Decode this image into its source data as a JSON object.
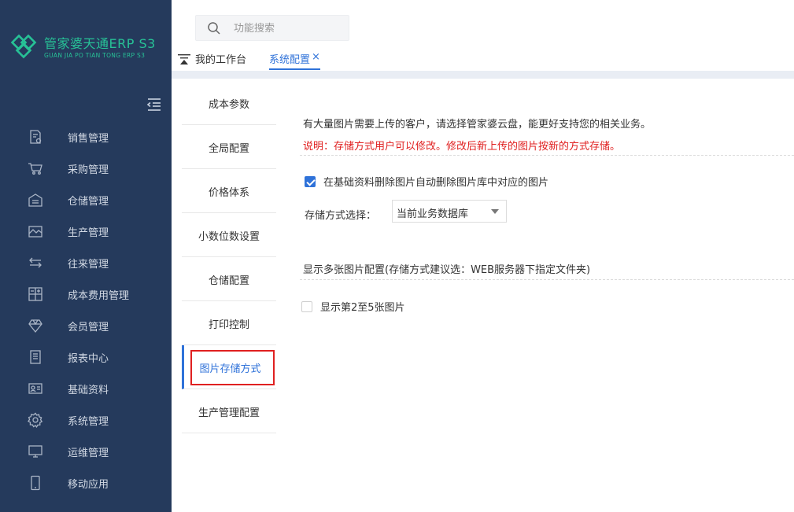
{
  "app": {
    "logo_title": "管家婆天通ERP S3",
    "logo_subtitle": "GUAN JIA PO TIAN TONG ERP S3"
  },
  "sidebar": {
    "items": [
      {
        "label": "销售管理",
        "icon": "sales-doc-icon"
      },
      {
        "label": "采购管理",
        "icon": "cart-icon"
      },
      {
        "label": "仓储管理",
        "icon": "warehouse-icon"
      },
      {
        "label": "生产管理",
        "icon": "factory-icon"
      },
      {
        "label": "往来管理",
        "icon": "exchange-arrows-icon"
      },
      {
        "label": "成本费用管理",
        "icon": "calculator-icon"
      },
      {
        "label": "会员管理",
        "icon": "diamond-icon"
      },
      {
        "label": "报表中心",
        "icon": "report-icon"
      },
      {
        "label": "基础资料",
        "icon": "id-card-icon"
      },
      {
        "label": "系统管理",
        "icon": "gear-icon"
      },
      {
        "label": "运维管理",
        "icon": "monitor-icon"
      },
      {
        "label": "移动应用",
        "icon": "mobile-icon"
      }
    ]
  },
  "search": {
    "placeholder": "功能搜索"
  },
  "tabs": {
    "home_label": "我的工作台",
    "active_label": "系统配置",
    "close_glyph": "×"
  },
  "settings_menu": {
    "items": [
      {
        "label": "成本参数"
      },
      {
        "label": "全局配置"
      },
      {
        "label": "价格体系"
      },
      {
        "label": "小数位数设置"
      },
      {
        "label": "仓储配置"
      },
      {
        "label": "打印控制"
      },
      {
        "label": "图片存储方式",
        "active": true
      },
      {
        "label": "生产管理配置"
      }
    ]
  },
  "content": {
    "note": "有大量图片需要上传的客户，请选择管家婆云盘，能更好支持您的相关业务。",
    "warning": "说明：存储方式用户可以修改。修改后新上传的图片按新的方式存储。",
    "auto_delete": {
      "label": "在基础资料删除图片自动删除图片库中对应的图片",
      "checked": true
    },
    "storage": {
      "label": "存储方式选择：",
      "selected": "当前业务数据库"
    },
    "multi_image_title": "显示多张图片配置(存储方式建议选：WEB服务器下指定文件夹)",
    "show_multi": {
      "label": "显示第2至5张图片",
      "checked": false
    }
  },
  "colors": {
    "sidebar_bg": "#253a5c",
    "brand_green": "#27c196",
    "accent_blue": "#2f72d9",
    "warning_red": "#e02020"
  }
}
